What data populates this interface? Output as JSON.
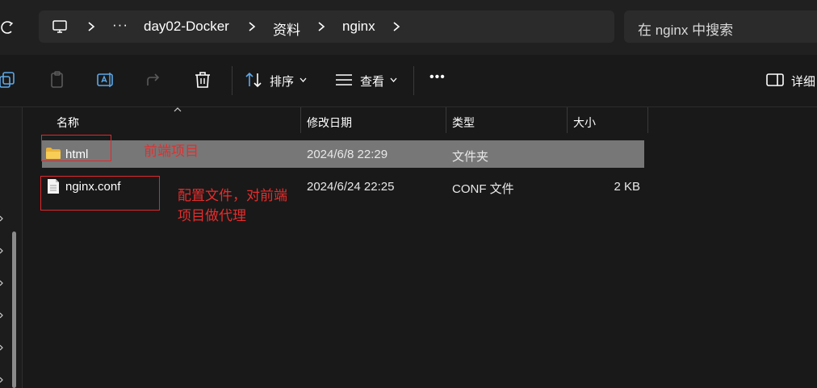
{
  "breadcrumb": {
    "overflow": "···",
    "items": [
      "day02-Docker",
      "资料",
      "nginx"
    ]
  },
  "search": {
    "placeholder": "在 nginx 中搜索"
  },
  "toolbar": {
    "sort_label": "排序",
    "view_label": "查看",
    "more_label": "•••",
    "details_label": "详细"
  },
  "columns": {
    "name": "名称",
    "date": "修改日期",
    "type": "类型",
    "size": "大小"
  },
  "files": [
    {
      "name": "html",
      "date": "2024/6/8 22:29",
      "type": "文件夹",
      "size": "",
      "icon": "folder-icon",
      "selected": true
    },
    {
      "name": "nginx.conf",
      "date": "2024/6/24 22:25",
      "type": "CONF 文件",
      "size": "2 KB",
      "icon": "document-icon",
      "selected": false
    }
  ],
  "annotations": {
    "html_note": "前端项目",
    "conf_note_line1": "配置文件，对前端",
    "conf_note_line2": "项目做代理"
  },
  "colors": {
    "annotation": "#e0272c",
    "selection": "#777777",
    "background": "#191919"
  }
}
